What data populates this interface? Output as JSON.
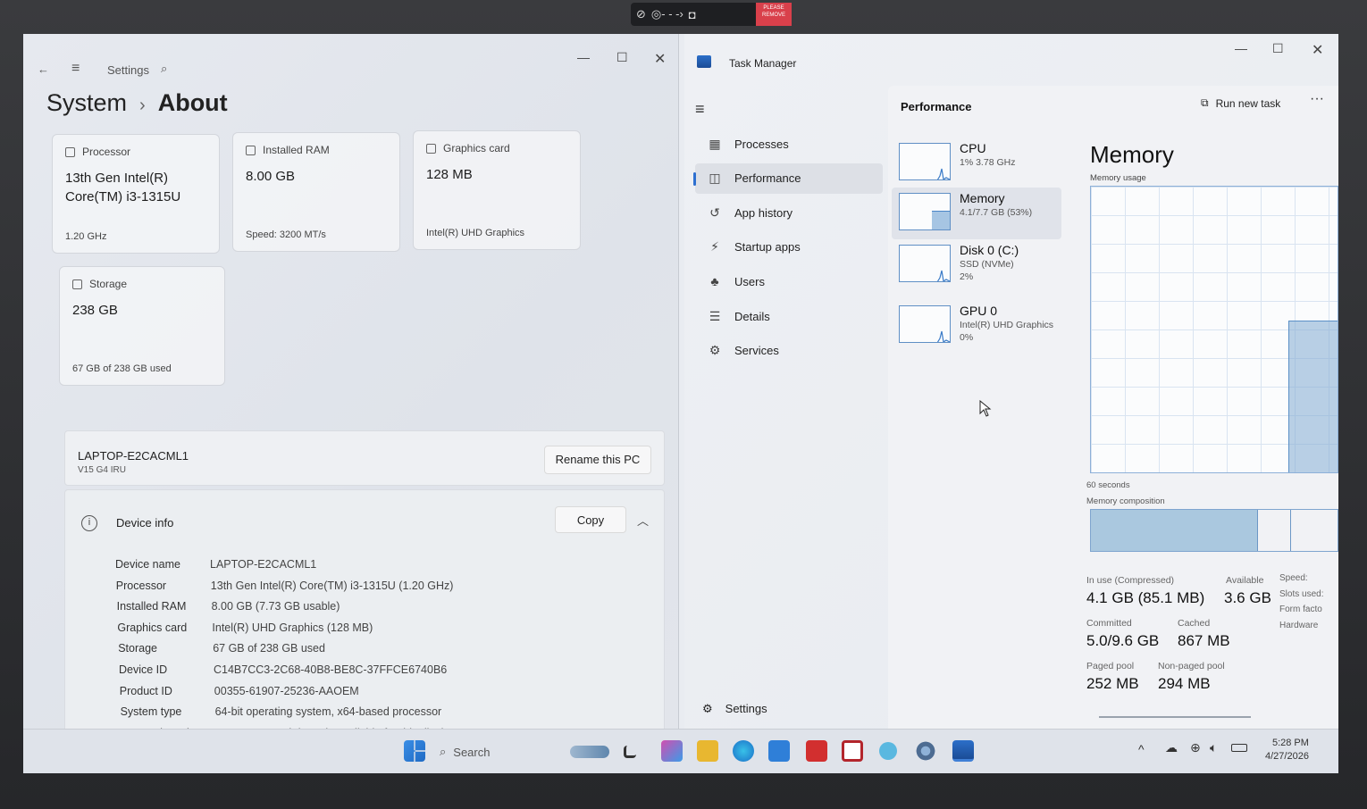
{
  "camera_badge": "PLEASE REMOVE",
  "settings": {
    "app_title": "Settings",
    "breadcrumb_parent": "System",
    "breadcrumb_sep": "›",
    "breadcrumb_current": "About",
    "cards": {
      "processor": {
        "label": "Processor",
        "value": "13th Gen Intel(R) Core(TM) i3-1315U",
        "sub": "1.20 GHz"
      },
      "ram": {
        "label": "Installed RAM",
        "value": "8.00 GB",
        "sub": "Speed: 3200 MT/s"
      },
      "gpu": {
        "label": "Graphics card",
        "value": "128 MB",
        "sub": "Intel(R) UHD Graphics"
      },
      "storage": {
        "label": "Storage",
        "value": "238 GB",
        "sub": "67 GB of 238 GB used"
      }
    },
    "pc_name": "LAPTOP-E2CACML1",
    "pc_model": "V15 G4 IRU",
    "rename_button": "Rename this PC",
    "device_info_header": "Device info",
    "copy_button": "Copy",
    "specs": [
      {
        "key": "Device name",
        "value": "LAPTOP-E2CACML1"
      },
      {
        "key": "Processor",
        "value": "13th Gen Intel(R) Core(TM) i3-1315U (1.20 GHz)"
      },
      {
        "key": "Installed RAM",
        "value": "8.00 GB (7.73 GB usable)"
      },
      {
        "key": "Graphics card",
        "value": "Intel(R) UHD Graphics (128 MB)"
      },
      {
        "key": "Storage",
        "value": "67 GB of 238 GB used"
      },
      {
        "key": "Device ID",
        "value": "C14B7CC3-2C68-40B8-BE8C-37FFCE6740B6"
      },
      {
        "key": "Product ID",
        "value": "00355-61907-25236-AAOEM"
      },
      {
        "key": "System type",
        "value": "64-bit operating system, x64-based processor"
      },
      {
        "key": "Pen and touch",
        "value": "No pen or touch input is available for this display"
      }
    ]
  },
  "taskmgr": {
    "title": "Task Manager",
    "nav": [
      {
        "label": "Processes",
        "icon": "processes-icon"
      },
      {
        "label": "Performance",
        "icon": "performance-icon"
      },
      {
        "label": "App history",
        "icon": "history-icon"
      },
      {
        "label": "Startup apps",
        "icon": "startup-icon"
      },
      {
        "label": "Users",
        "icon": "users-icon"
      },
      {
        "label": "Details",
        "icon": "details-icon"
      },
      {
        "label": "Services",
        "icon": "services-icon"
      }
    ],
    "settings_label": "Settings",
    "perf_header": "Performance",
    "run_new_task": "Run new task",
    "resources": [
      {
        "name": "CPU",
        "line1": "1% 3.78 GHz",
        "line2": ""
      },
      {
        "name": "Memory",
        "line1": "4.1/7.7 GB (53%)",
        "line2": ""
      },
      {
        "name": "Disk 0 (C:)",
        "line1": "SSD (NVMe)",
        "line2": "2%"
      },
      {
        "name": "GPU 0",
        "line1": "Intel(R) UHD Graphics",
        "line2": "0%"
      }
    ],
    "memory": {
      "title": "Memory",
      "usage_label": "Memory usage",
      "usage_fraction": 0.53,
      "time_label": "60 seconds",
      "composition_label": "Memory composition",
      "stats": {
        "in_use_label": "In use (Compressed)",
        "in_use": "4.1 GB (85.1 MB)",
        "available_label": "Available",
        "available": "3.6 GB",
        "committed_label": "Committed",
        "committed": "5.0/9.6 GB",
        "cached_label": "Cached",
        "cached": "867 MB",
        "paged_label": "Paged pool",
        "paged": "252 MB",
        "nonpaged_label": "Non-paged pool",
        "nonpaged": "294 MB",
        "side_labels": [
          "Speed:",
          "Slots used:",
          "Form facto",
          "Hardware"
        ]
      }
    }
  },
  "taskbar": {
    "search_label": "Search",
    "time": "5:28 PM",
    "date": "4/27/2026"
  }
}
